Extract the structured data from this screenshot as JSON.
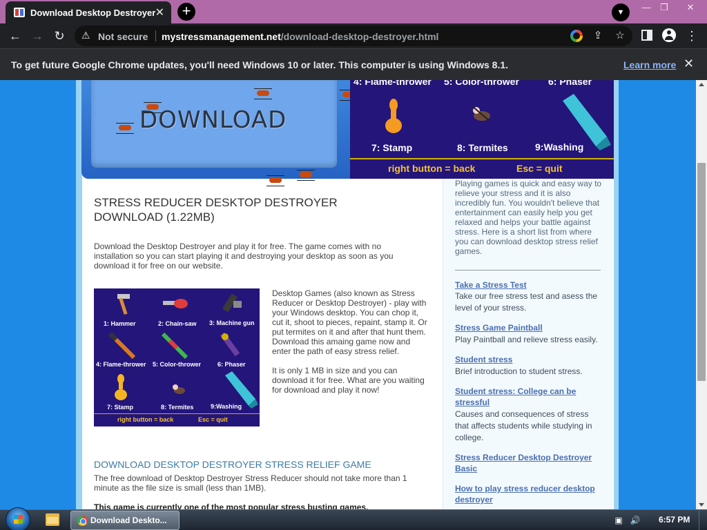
{
  "browser": {
    "tab_title": "Download Desktop Destroyer",
    "tab_close": "✕",
    "new_tab": "+",
    "address": {
      "security_label": "Not secure",
      "domain": "mystressmanagement.net",
      "path": "/download-desktop-destroyer.html"
    },
    "infobar": {
      "message": "To get future Google Chrome updates, you'll need Windows 10 or later. This computer is using Windows 8.1.",
      "link": "Learn more"
    }
  },
  "banner": {
    "download_text": "DOWNLOAD",
    "tools_top": [
      "4: Flame-thrower",
      "5: Color-thrower",
      "6: Phaser"
    ],
    "tools_bottom": [
      "7: Stamp",
      "8: Termites",
      "9:Washing"
    ],
    "right_key": "right button = back",
    "esc_key": "Esc = quit"
  },
  "main": {
    "title": "STRESS REDUCER DESKTOP DESTROYER DOWNLOAD (1.22MB)",
    "intro": "Download the Desktop Destroyer and play it for free. The game comes with no installation so you can start playing it and destroying your desktop as soon as you download it for free on our website.",
    "game_image": {
      "labels": [
        "1: Hammer",
        "2: Chain-saw",
        "3: Machine gun",
        "4: Flame-thrower",
        "5: Color-thrower",
        "6: Phaser",
        "7: Stamp",
        "8: Termites",
        "9:Washing"
      ],
      "right_key": "right button = back",
      "esc_key": "Esc = quit"
    },
    "side_text_1": "Desktop Games (also known as Stress Reducer or Desktop Destroyer) - play with your Windows desktop. You can chop it, cut it, shoot to pieces, repaint, stamp it. Or put termites on it and after that hunt them. Download this amaing game now and enter the path of easy stress relief.",
    "side_text_2": "It is only 1 MB in size and you can download it for free. What are you waiting for download and play it now!",
    "subtitle": "DOWNLOAD DESKTOP DESTROYER STRESS RELIEF GAME",
    "para_2": "The free download of Desktop Destroyer Stress Reducer should not take more than 1 minute as the file size is small (less than 1MB).",
    "para_3": "This game is currently one of the most popular stress busting games."
  },
  "sidebar": {
    "intro": "Playing games is quick and easy way to relieve your stress and it is also incredibly fun. You wouldn't believe that entertainment can easily help you get relaxed and helps your battle against stress. Here is a short list from where you can download desktop stress relief games.",
    "links": [
      {
        "label": "Take a Stress Test",
        "desc": "Take our free stress test and asess the level of your stress."
      },
      {
        "label": "Stress Game Paintball",
        "desc": "Play Paintball and relieve stress easily."
      },
      {
        "label": "Student stress",
        "desc": "Brief introduction to student stress."
      },
      {
        "label": "Student stress: College can be stressful",
        "desc": "Causes and consequences of stress that affects students while studying in college."
      },
      {
        "label": "Stress Reducer Desktop Destroyer Basic",
        "desc": ""
      },
      {
        "label": "How to play stress reducer desktop destroyer",
        "desc": ""
      }
    ]
  },
  "taskbar": {
    "chrome_label": "Download Deskto...",
    "clock": "6:57 PM"
  },
  "colors": {
    "page_bg": "#1e8ae6",
    "banner_dark": "#24157a",
    "key_text": "#f4c430",
    "link": "#4a6fb0"
  }
}
